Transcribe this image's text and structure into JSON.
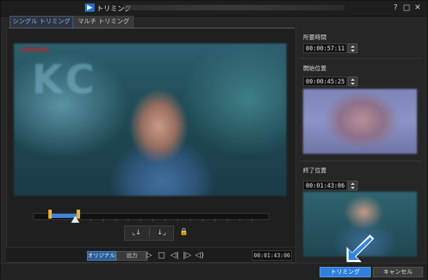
{
  "window": {
    "title": "トリミング",
    "help_icon": "help-icon",
    "maximize_icon": "maximize-icon",
    "close_icon": "close-icon",
    "help_label": "?",
    "maximize_label": "□",
    "close_label": "✕"
  },
  "tabs": [
    {
      "label": "シングル トリミング",
      "active": true
    },
    {
      "label": "マルチ トリミング",
      "active": false
    }
  ],
  "timeline": {
    "playhead_fraction": 0.18,
    "in_fraction": 0.07,
    "out_fraction": 0.19
  },
  "mark": {
    "mark_in_label": "⌞↓",
    "mark_out_label": "↓⌟"
  },
  "controls": {
    "original_label": "オリジナル",
    "output_label": "出力",
    "play_label": "▷",
    "stop_label": "□",
    "prev_frame_label": "◁|",
    "next_frame_label": "|▷",
    "volume_label": "◁)",
    "timecode": "00:01:43:06"
  },
  "right": {
    "duration_label": "所要時間",
    "duration_value": "00:00:57:11",
    "start_label": "開始位置",
    "start_value": "00:00:45:25",
    "end_label": "終了位置",
    "end_value": "00:01:43:06"
  },
  "footer": {
    "ok_label": "トリミング",
    "cancel_label": "キャンセル"
  },
  "colors": {
    "accent": "#2f7fdc",
    "marker": "#f0b030",
    "selection": "#3b87d6"
  }
}
